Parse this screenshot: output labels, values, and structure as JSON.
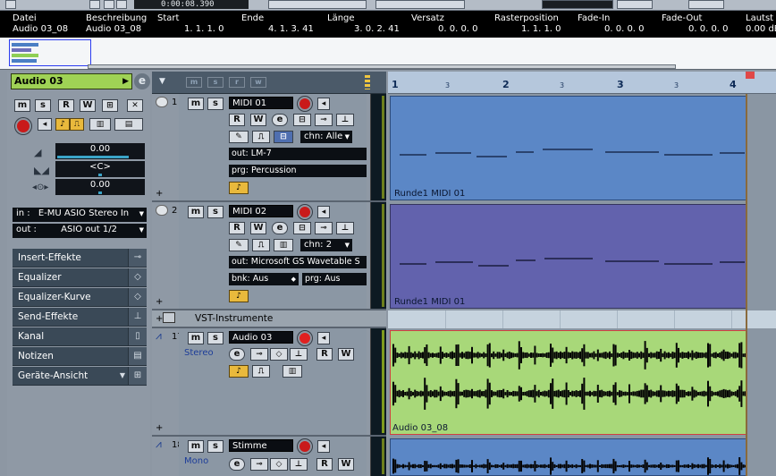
{
  "transport": {
    "time": "0:00:08.390"
  },
  "info_line": {
    "columns": [
      {
        "header": "Datei",
        "value": "Audio 03_08"
      },
      {
        "header": "Beschreibung",
        "value": "Audio 03_08"
      },
      {
        "header": "Start",
        "value": "1. 1. 1.   0"
      },
      {
        "header": "Ende",
        "value": "4. 1. 3. 41"
      },
      {
        "header": "Länge",
        "value": "3. 0. 2. 41"
      },
      {
        "header": "Versatz",
        "value": "0. 0. 0.   0"
      },
      {
        "header": "Rasterposition",
        "value": "1. 1. 1.   0"
      },
      {
        "header": "Fade-In",
        "value": "0. 0. 0.   0"
      },
      {
        "header": "Fade-Out",
        "value": "0. 0. 0.   0"
      },
      {
        "header": "Lautst",
        "value": "0.00 dB"
      }
    ]
  },
  "inspector": {
    "title": "Audio 03",
    "e_label": "e",
    "top_buttons": [
      "m",
      "s",
      "R",
      "W"
    ],
    "volume": "0.00",
    "pan": "<C>",
    "delay": "0.00",
    "input_label": "in :",
    "input_value": "E-MU ASIO Stereo In",
    "output_label": "out :",
    "output_value": "ASIO out 1/2",
    "sections": [
      "Insert-Effekte",
      "Equalizer",
      "Equalizer-Kurve",
      "Send-Effekte",
      "Kanal",
      "Notizen",
      "Geräte-Ansicht"
    ]
  },
  "tracklist": {
    "header_buttons": [
      "m",
      "s",
      "r",
      "w"
    ],
    "tracks": [
      {
        "number": "1",
        "name": "MIDI 01",
        "chn": "chn: Alle",
        "out": "out: LM-7",
        "prg": "prg: Percussion"
      },
      {
        "number": "2",
        "name": "MIDI 02",
        "chn": "chn: 2",
        "out": "out: Microsoft GS Wavetable S",
        "bnk": "bnk: Aus",
        "prg": "prg: Aus"
      },
      {
        "number": "",
        "name": "VST-Instrumente"
      },
      {
        "number": "17",
        "name": "Audio 03",
        "mode": "Stereo"
      },
      {
        "number": "18",
        "name": "Stimme",
        "mode": "Mono"
      }
    ],
    "button_labels": {
      "m": "m",
      "s": "s",
      "r": "R",
      "w": "W",
      "e": "e"
    }
  },
  "arrange": {
    "bar_labels": [
      "1",
      "2",
      "3",
      "4"
    ],
    "beat_labels": [
      "3",
      "3",
      "3"
    ],
    "parts": [
      {
        "caption": "Runde1 MIDI 01",
        "color": "#5b87c6"
      },
      {
        "caption": "Runde1 MIDI 01",
        "color": "#6262ad"
      },
      {
        "caption": "Audio 03_08",
        "color": "#a8d879"
      }
    ]
  }
}
